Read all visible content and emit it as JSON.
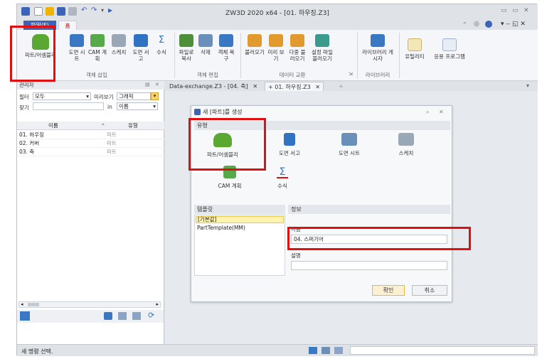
{
  "window": {
    "title": "ZW3D 2020 x64 - [01. 하우징.Z3]",
    "controls": [
      "▭",
      "▭",
      "✕"
    ]
  },
  "menu": {
    "file_tab": "파일(F)",
    "home_tab": "홈"
  },
  "ribbon": {
    "groups": [
      {
        "label": "객체 삽입",
        "buttons": [
          {
            "label": "파트/어셈블리",
            "icon": "part-assembly-icon"
          },
          {
            "label": "도면 시트",
            "icon": "drawing-sheet-icon"
          },
          {
            "label": "CAM 계획",
            "icon": "cam-plan-icon"
          },
          {
            "label": "스케치",
            "icon": "sketch-icon"
          },
          {
            "label": "도면 서고",
            "icon": "drawing-pack-icon"
          },
          {
            "label": "수식",
            "icon": "equation-icon"
          }
        ]
      },
      {
        "label": "객체 편집",
        "buttons": [
          {
            "label": "파일로 복사",
            "icon": "copy-to-file-icon"
          },
          {
            "label": "삭제",
            "icon": "delete-icon"
          },
          {
            "label": "객체 복구",
            "icon": "restore-icon"
          }
        ]
      },
      {
        "label": "데이터 교환",
        "buttons": [
          {
            "label": "불러오기",
            "icon": "import-icon"
          },
          {
            "label": "미리 보기",
            "icon": "preview-icon"
          },
          {
            "label": "다중 불러오기",
            "icon": "multi-import-icon"
          },
          {
            "label": "설정 파일 불러오기",
            "icon": "config-import-icon"
          }
        ]
      },
      {
        "label": "라이브러리",
        "buttons": [
          {
            "label": "라이브러리 게시자",
            "icon": "library-publisher-icon"
          }
        ]
      },
      {
        "label": "",
        "buttons": [
          {
            "label": "유틸리티",
            "icon": "utility-icon"
          },
          {
            "label": "응용 프로그램",
            "icon": "application-icon"
          }
        ]
      }
    ]
  },
  "manager": {
    "title": "관리자",
    "filter_label": "필터",
    "filter_value": "모두",
    "preview_label": "미리보기",
    "preview_value": "그래픽",
    "find_label": "찾기",
    "in_label": "in",
    "in_value": "이름",
    "columns": [
      "이름",
      "유형"
    ],
    "rows": [
      {
        "name": "01. 하우징",
        "type": "파트"
      },
      {
        "name": "02. 커버",
        "type": "파트"
      },
      {
        "name": "03. 축",
        "type": "파트"
      }
    ]
  },
  "doc_tabs": [
    {
      "label": "Data-exchange.Z3 - [04. 축]"
    },
    {
      "label": "01. 하우징.Z3"
    }
  ],
  "dialog": {
    "title": "새 [파트]를 생성",
    "type_section": "유형",
    "types": [
      {
        "label": "파트/어셈블리",
        "icon": "part-assembly-icon"
      },
      {
        "label": "도면 서고",
        "icon": "drawing-pack-icon"
      },
      {
        "label": "도면 시트",
        "icon": "drawing-sheet-icon"
      },
      {
        "label": "스케치",
        "icon": "sketch-icon"
      },
      {
        "label": "CAM 계획",
        "icon": "cam-plan-icon"
      },
      {
        "label": "수식",
        "icon": "equation-icon"
      }
    ],
    "template_section": "템플릿",
    "templates": [
      "[기본값]",
      "PartTemplate(MM)"
    ],
    "info_section": "정보",
    "name_label": "이름",
    "name_value": "04. 스퍼기어",
    "desc_label": "설명",
    "desc_value": "",
    "ok_label": "확인",
    "cancel_label": "취소"
  },
  "status": {
    "text": "새 명령 선택."
  },
  "colors": {
    "highlight_red": "#e01010",
    "file_tab_blue": "#3b63b6",
    "selected_row": "#fff3b0"
  }
}
